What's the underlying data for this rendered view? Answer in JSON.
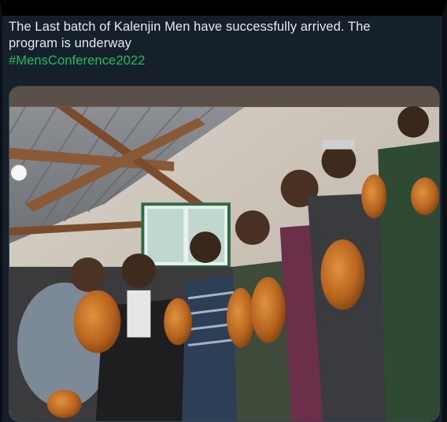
{
  "tweet": {
    "text_line1": "The Last batch of Kalenjin Men have successfully arrived. The",
    "text_line2": "program is underway",
    "hashtag": "#MensConference2022"
  },
  "media": {
    "icon": "photo",
    "description_hidden": ""
  },
  "colors": {
    "background": "#15202b",
    "text": "#e7e9ea",
    "hashtag": "#17bf63",
    "border": "#38444d"
  }
}
